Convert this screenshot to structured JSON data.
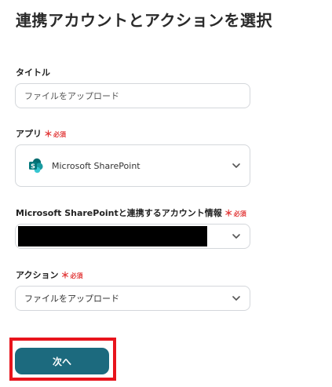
{
  "header": {
    "title": "連携アカウントとアクションを選択"
  },
  "required": {
    "mark": "＊",
    "text": "必須"
  },
  "fields": {
    "title": {
      "label": "タイトル",
      "value": "ファイルをアップロード"
    },
    "app": {
      "label": "アプリ",
      "value": "Microsoft SharePoint",
      "icon": "sharepoint-icon"
    },
    "account": {
      "label": "Microsoft SharePointと連携するアカウント情報",
      "value": ""
    },
    "action": {
      "label": "アクション",
      "value": "ファイルをアップロード"
    }
  },
  "footer": {
    "next_label": "次へ"
  },
  "colors": {
    "accent": "#1c6a7e",
    "required": "#e23b3b",
    "highlight": "#e8141c",
    "sharepoint": "#038387"
  }
}
